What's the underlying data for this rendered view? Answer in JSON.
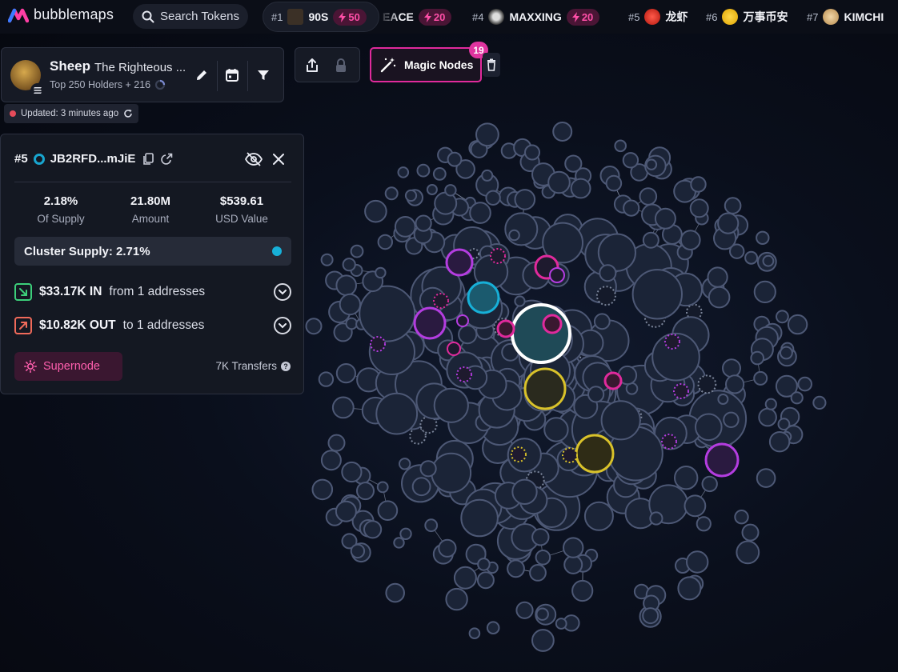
{
  "app": {
    "name": "bubblemaps"
  },
  "search": {
    "label": "Search Tokens"
  },
  "trending": [
    {
      "rank": "#1",
      "name": "90S",
      "boost": "50"
    },
    {
      "rank": "",
      "name": "EACE",
      "boost": "20"
    },
    {
      "rank": "#4",
      "name": "MAXXING",
      "boost": "20"
    },
    {
      "rank": "#5",
      "name": "龙虾",
      "boost": ""
    },
    {
      "rank": "#6",
      "name": "万事币安",
      "boost": ""
    },
    {
      "rank": "#7",
      "name": "KIMCHI",
      "boost": ""
    }
  ],
  "token": {
    "symbol": "Sheep",
    "full_name": "The Righteous ...",
    "subtitle": "Top 250 Holders + 216"
  },
  "magic_nodes": {
    "label": "Magic Nodes",
    "count": "19"
  },
  "updated": {
    "label": "Updated: 3 minutes ago"
  },
  "address_panel": {
    "rank": "#5",
    "address": "JB2RFD...mJiE",
    "stats": [
      {
        "value": "2.18%",
        "label": "Of Supply"
      },
      {
        "value": "21.80M",
        "label": "Amount"
      },
      {
        "value": "$539.61",
        "label": "USD Value"
      }
    ],
    "cluster_supply": "Cluster Supply: 2.71%",
    "inflow": {
      "amount": "$33.17K IN",
      "desc": "from 1 addresses"
    },
    "outflow": {
      "amount": "$10.82K OUT",
      "desc": "to 1 addresses"
    },
    "supernode_label": "Supernode",
    "transfers": "7K Transfers"
  },
  "colors": {
    "accent_pink": "#e02a9c",
    "cyan": "#17b0d8",
    "gold": "#d9c22a",
    "purple": "#b43de0",
    "bubble_fill": "#1b2437",
    "bubble_stroke": "#4d5875"
  },
  "icons": [
    "bubblemaps-logo-icon",
    "search-icon",
    "lightning-icon",
    "pencil-icon",
    "calendar-icon",
    "filter-icon",
    "share-icon",
    "lock-icon",
    "magic-wand-icon",
    "trash-icon",
    "refresh-icon",
    "copy-icon",
    "external-link-icon",
    "eye-off-icon",
    "close-icon",
    "inflow-arrow-icon",
    "outflow-arrow-icon",
    "chevron-down-icon",
    "sun-icon",
    "help-icon"
  ]
}
